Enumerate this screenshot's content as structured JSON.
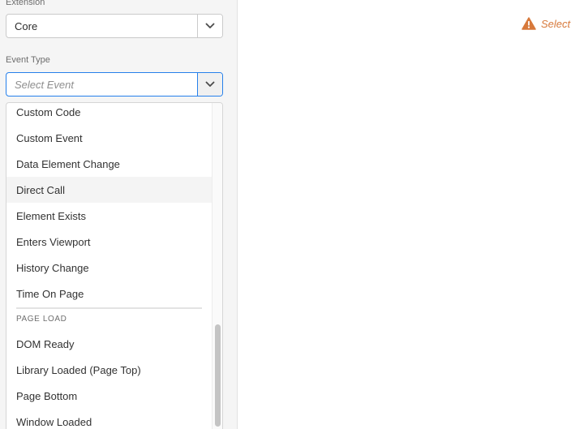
{
  "extension": {
    "label": "Extension",
    "value": "Core"
  },
  "event_type": {
    "label": "Event Type",
    "placeholder": "Select Event"
  },
  "menu": {
    "items_top": [
      "Custom Code",
      "Custom Event",
      "Data Element Change",
      "Direct Call",
      "Element Exists",
      "Enters Viewport",
      "History Change",
      "Time On Page"
    ],
    "hovered_item": "Direct Call",
    "section_page_load": "PAGE LOAD",
    "items_page_load": [
      "DOM Ready",
      "Library Loaded (Page Top)",
      "Page Bottom",
      "Window Loaded"
    ]
  },
  "warning": {
    "text": "Select an event type"
  },
  "colors": {
    "accent": "#2680eb",
    "warning": "#d7793b",
    "panel_bg": "#f5f5f5"
  }
}
